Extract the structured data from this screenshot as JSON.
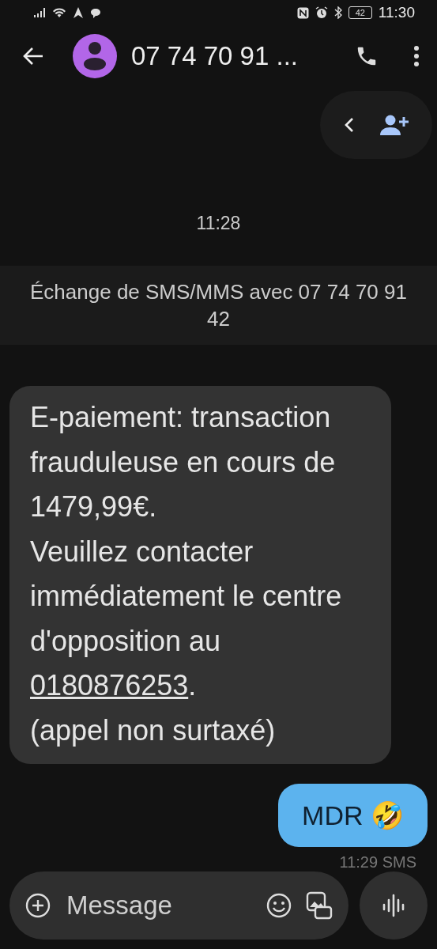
{
  "status_bar": {
    "time": "11:30",
    "battery": "42"
  },
  "header": {
    "contact": "07 74 70 91 ..."
  },
  "timestamp": "11:28",
  "banner": "Échange de SMS/MMS avec 07 74 70 91 42",
  "messages": [
    {
      "kind": "incoming",
      "text_before": "E-paiement: transaction frauduleuse en cours de 1479,99€.\nVeuillez contacter immédiatement le centre d'opposition au ",
      "link": "0180876253",
      "text_after": ".\n(appel non surtaxé)"
    },
    {
      "kind": "outgoing",
      "text": "MDR 🤣",
      "meta": "11:29 SMS"
    }
  ],
  "composer": {
    "placeholder": "Message"
  }
}
